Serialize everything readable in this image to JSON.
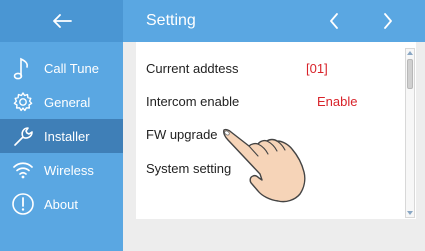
{
  "header": {
    "back_icon": "arrow-left-icon",
    "title": "Setting",
    "prev_icon": "chevron-left-icon",
    "next_icon": "chevron-right-icon",
    "color": "#5aa7e2"
  },
  "sidebar": {
    "active_color": "#3f7fb7",
    "items": [
      {
        "label": "Call Tune",
        "icon": "music-note-icon",
        "active": false
      },
      {
        "label": "General",
        "icon": "gear-icon",
        "active": false
      },
      {
        "label": "Installer",
        "icon": "wrench-icon",
        "active": true
      },
      {
        "label": "Wireless",
        "icon": "wifi-icon",
        "active": false
      },
      {
        "label": "About",
        "icon": "info-icon",
        "active": false
      }
    ]
  },
  "settings": {
    "rows": [
      {
        "label": "Current addtess",
        "value": "[01]"
      },
      {
        "label": "Intercom enable",
        "value": "Enable"
      },
      {
        "label": "FW upgrade",
        "value": ""
      },
      {
        "label": "System setting",
        "value": ""
      }
    ],
    "value_color": "#d8232a"
  },
  "overlay": {
    "icon": "pointing-hand-icon"
  }
}
